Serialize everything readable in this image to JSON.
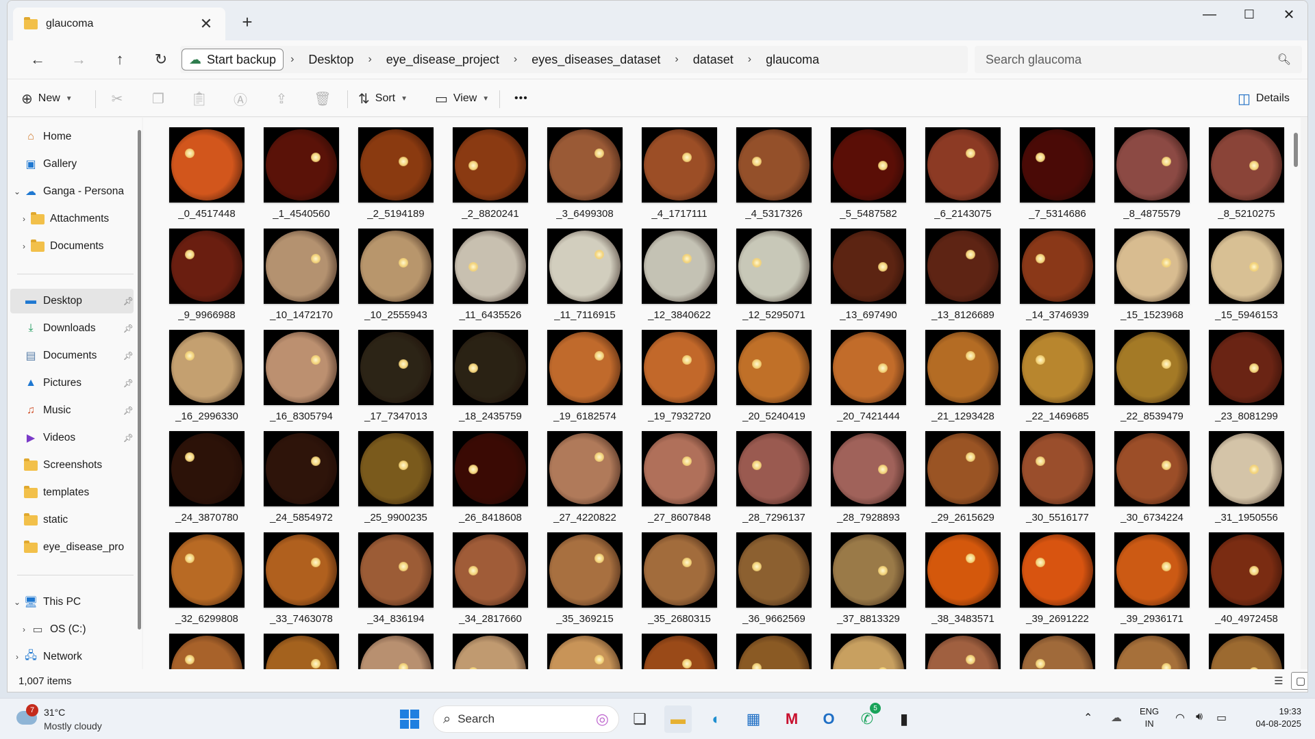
{
  "window": {
    "tab_title": "glaucoma",
    "new_tab": "+",
    "close_tab": "✕",
    "minimize": "—",
    "maximize": "☐",
    "close": "✕"
  },
  "addressbar": {
    "backup_label": "Start backup",
    "crumbs": [
      "Desktop",
      "eye_disease_project",
      "eyes_diseases_dataset",
      "dataset",
      "glaucoma"
    ],
    "separator": "›",
    "search_placeholder": "Search glaucoma"
  },
  "commandbar": {
    "new_label": "New",
    "sort_label": "Sort",
    "view_label": "View",
    "more": "•••",
    "details_label": "Details"
  },
  "sidebar": {
    "items": [
      {
        "label": "Home",
        "icon": "home-icon"
      },
      {
        "label": "Gallery",
        "icon": "gallery-icon"
      },
      {
        "label": "Ganga - Persona",
        "icon": "onedrive-icon"
      },
      {
        "label": "Attachments",
        "icon": "folder-icon"
      },
      {
        "label": "Documents",
        "icon": "folder-icon"
      },
      {
        "label": "Desktop",
        "icon": "desktop-icon"
      },
      {
        "label": "Downloads",
        "icon": "downloads-icon"
      },
      {
        "label": "Documents",
        "icon": "documents-icon"
      },
      {
        "label": "Pictures",
        "icon": "pictures-icon"
      },
      {
        "label": "Music",
        "icon": "music-icon"
      },
      {
        "label": "Videos",
        "icon": "videos-icon"
      },
      {
        "label": "Screenshots",
        "icon": "folder-icon"
      },
      {
        "label": "templates",
        "icon": "folder-icon"
      },
      {
        "label": "static",
        "icon": "folder-icon"
      },
      {
        "label": "eye_disease_pro",
        "icon": "folder-icon"
      },
      {
        "label": "This PC",
        "icon": "this-pc-icon"
      },
      {
        "label": "OS (C:)",
        "icon": "drive-icon"
      },
      {
        "label": "Network",
        "icon": "network-icon"
      }
    ]
  },
  "files": [
    {
      "name": "_0_4517448",
      "tone": "#d2561c"
    },
    {
      "name": "_1_4540560",
      "tone": "#5a1208"
    },
    {
      "name": "_2_5194189",
      "tone": "#8a3a10"
    },
    {
      "name": "_2_8820241",
      "tone": "#8a3a12"
    },
    {
      "name": "_3_6499308",
      "tone": "#9a5a36"
    },
    {
      "name": "_4_1717111",
      "tone": "#9c4e26"
    },
    {
      "name": "_4_5317326",
      "tone": "#94502a"
    },
    {
      "name": "_5_5487582",
      "tone": "#5a0e06"
    },
    {
      "name": "_6_2143075",
      "tone": "#8c3a24"
    },
    {
      "name": "_7_5314686",
      "tone": "#4a0a06"
    },
    {
      "name": "_8_4875579",
      "tone": "#8c4a44"
    },
    {
      "name": "_8_5210275",
      "tone": "#8a4438"
    },
    {
      "name": "_9_9966988",
      "tone": "#6a1e10"
    },
    {
      "name": "_10_1472170",
      "tone": "#b49270"
    },
    {
      "name": "_10_2555943",
      "tone": "#b8966c"
    },
    {
      "name": "_11_6435526",
      "tone": "#c8c0b0"
    },
    {
      "name": "_11_7116915",
      "tone": "#d2cebe"
    },
    {
      "name": "_12_3840622",
      "tone": "#c4c2b4"
    },
    {
      "name": "_12_5295071",
      "tone": "#c8c8b8"
    },
    {
      "name": "_13_697490",
      "tone": "#5c2412"
    },
    {
      "name": "_13_8126689",
      "tone": "#5e2414"
    },
    {
      "name": "_14_3746939",
      "tone": "#8a3818"
    },
    {
      "name": "_15_1523968",
      "tone": "#d8bc90"
    },
    {
      "name": "_15_5946153",
      "tone": "#d8c094"
    },
    {
      "name": "_16_2996330",
      "tone": "#c4a070"
    },
    {
      "name": "_16_8305794",
      "tone": "#bc9070"
    },
    {
      "name": "_17_7347013",
      "tone": "#2c2416"
    },
    {
      "name": "_18_2435759",
      "tone": "#2a2214"
    },
    {
      "name": "_19_6182574",
      "tone": "#c06a2c"
    },
    {
      "name": "_19_7932720",
      "tone": "#c2682a"
    },
    {
      "name": "_20_5240419",
      "tone": "#c07028"
    },
    {
      "name": "_20_7421444",
      "tone": "#c26c2a"
    },
    {
      "name": "_21_1293428",
      "tone": "#b46c24"
    },
    {
      "name": "_22_1469685",
      "tone": "#b8862e"
    },
    {
      "name": "_22_8539479",
      "tone": "#a47a26"
    },
    {
      "name": "_23_8081299",
      "tone": "#6a2414"
    },
    {
      "name": "_24_3870780",
      "tone": "#2c1208"
    },
    {
      "name": "_24_5854972",
      "tone": "#2e140a"
    },
    {
      "name": "_25_9900235",
      "tone": "#7a5a1c"
    },
    {
      "name": "_26_8418608",
      "tone": "#3a0a04"
    },
    {
      "name": "_27_4220822",
      "tone": "#b07a5a"
    },
    {
      "name": "_27_8607848",
      "tone": "#b0705a"
    },
    {
      "name": "_28_7296137",
      "tone": "#9a5a50"
    },
    {
      "name": "_28_7928893",
      "tone": "#a0625a"
    },
    {
      "name": "_29_2615629",
      "tone": "#9a5424"
    },
    {
      "name": "_30_5516177",
      "tone": "#9a4e2c"
    },
    {
      "name": "_30_6734224",
      "tone": "#9c4e28"
    },
    {
      "name": "_31_1950556",
      "tone": "#d4c4a8"
    },
    {
      "name": "_32_6299808",
      "tone": "#b86a24"
    },
    {
      "name": "_33_7463078",
      "tone": "#b0601e"
    },
    {
      "name": "_34_836194",
      "tone": "#9c5c36"
    },
    {
      "name": "_34_2817660",
      "tone": "#a05c38"
    },
    {
      "name": "_35_369215",
      "tone": "#a87040"
    },
    {
      "name": "_35_2680315",
      "tone": "#a26c3c"
    },
    {
      "name": "_36_9662569",
      "tone": "#8c6030"
    },
    {
      "name": "_37_8813329",
      "tone": "#9a7a48"
    },
    {
      "name": "_38_3483571",
      "tone": "#d4580c"
    },
    {
      "name": "_39_2691222",
      "tone": "#d85410"
    },
    {
      "name": "_39_2936171",
      "tone": "#cc5a14"
    },
    {
      "name": "_40_4972458",
      "tone": "#7a2c12"
    },
    {
      "name": "",
      "tone": "#a8622a"
    },
    {
      "name": "",
      "tone": "#a4621e"
    },
    {
      "name": "",
      "tone": "#b89070"
    },
    {
      "name": "",
      "tone": "#c09a70"
    },
    {
      "name": "",
      "tone": "#c89458"
    },
    {
      "name": "",
      "tone": "#9a4a18"
    },
    {
      "name": "",
      "tone": "#8a5a24"
    },
    {
      "name": "",
      "tone": "#c8a060"
    },
    {
      "name": "",
      "tone": "#a06040"
    },
    {
      "name": "",
      "tone": "#a06a3a"
    },
    {
      "name": "",
      "tone": "#a6703a"
    },
    {
      "name": "",
      "tone": "#9c6a30"
    }
  ],
  "status": {
    "item_count": "1,007 items"
  },
  "taskbar": {
    "temperature": "31°C",
    "condition": "Mostly cloudy",
    "weather_badge": "7",
    "search_label": "Search",
    "whatsapp_badge": "5",
    "lang_top": "ENG",
    "lang_bottom": "IN",
    "time": "19:33",
    "date": "04-08-2025"
  }
}
